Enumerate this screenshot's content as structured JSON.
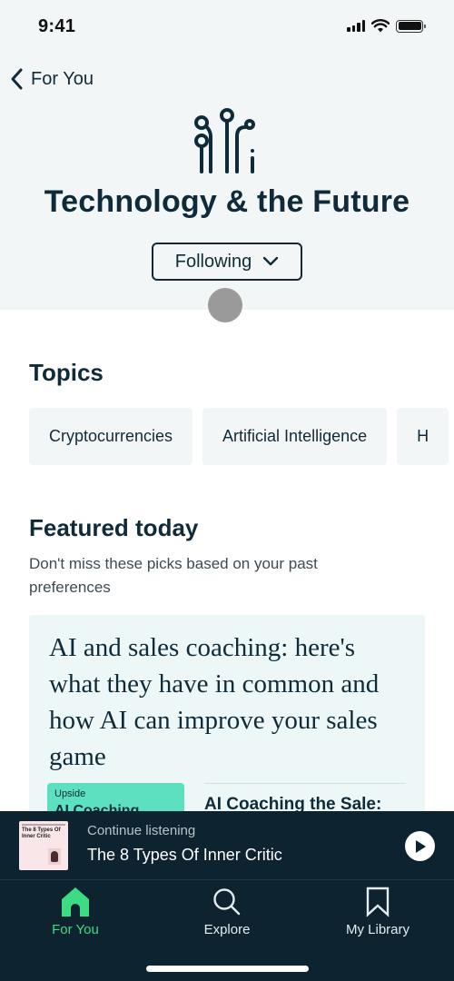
{
  "status_bar": {
    "time": "9:41"
  },
  "nav": {
    "back_label": "For You"
  },
  "category": {
    "icon": "circuit-icon",
    "title": "Technology & the Future",
    "follow_label": "Following"
  },
  "topics": {
    "title": "Topics",
    "items": [
      {
        "label": "Cryptocurrencies"
      },
      {
        "label": "Artificial Intelligence"
      },
      {
        "label": "H"
      }
    ]
  },
  "featured": {
    "title": "Featured today",
    "subtitle": "Don't miss these picks based on your past preferences",
    "card": {
      "headline": "AI and sales coaching: here's what they have in common and how AI can improve your sales game",
      "cover_publisher": "Upside",
      "cover_title": "AI Coaching",
      "book_title": "AI Coaching the Sale:"
    }
  },
  "mini_player": {
    "label": "Continue listening",
    "title": "The 8 Types Of Inner Critic",
    "art_title": "The 8 Types Of Inner Critic"
  },
  "tab_bar": {
    "tabs": [
      {
        "label": "For You",
        "icon": "home-icon",
        "active": true
      },
      {
        "label": "Explore",
        "icon": "search-icon",
        "active": false
      },
      {
        "label": "My Library",
        "icon": "bookmark-icon",
        "active": false
      }
    ]
  },
  "colors": {
    "navy": "#0f2b3a",
    "hero_bg": "#f2f6f7",
    "accent_green": "#3ddc84",
    "cover_teal": "#5de0c0",
    "tab_bar_bg": "#0e2330"
  }
}
